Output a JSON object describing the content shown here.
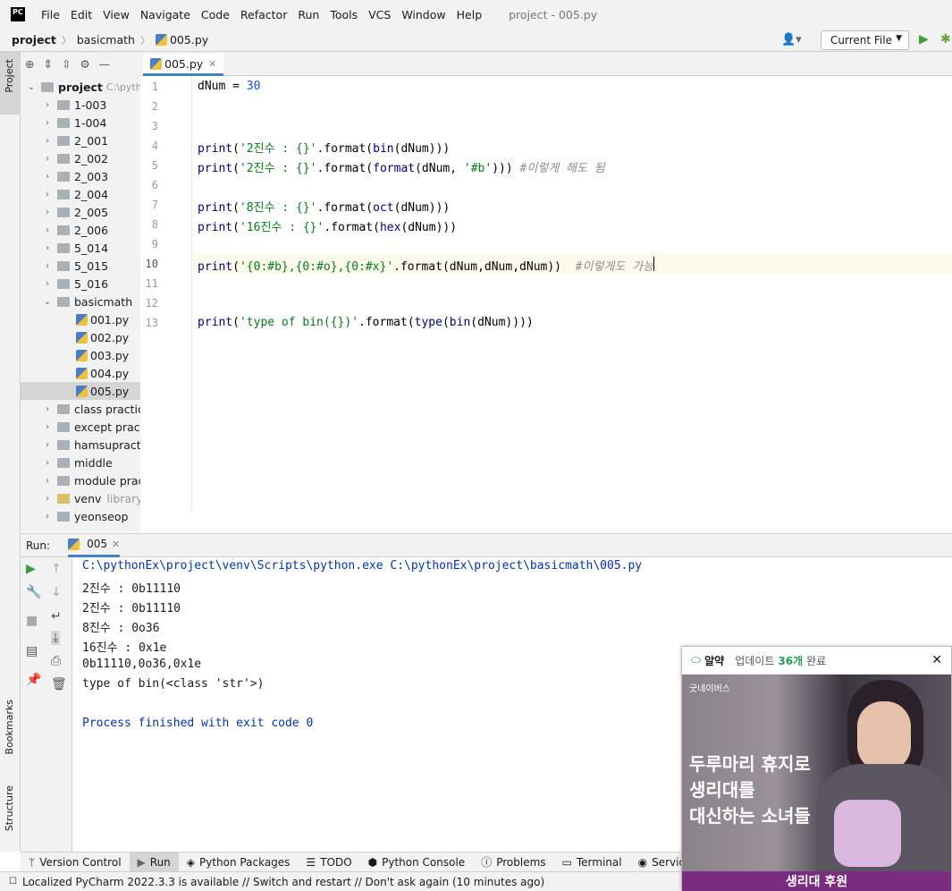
{
  "menubar": {
    "logo": "PC",
    "items": [
      "File",
      "Edit",
      "View",
      "Navigate",
      "Code",
      "Refactor",
      "Run",
      "Tools",
      "VCS",
      "Window",
      "Help"
    ],
    "window_title": "project - 005.py"
  },
  "navbar": {
    "crumbs": [
      "project",
      "basicmath",
      "005.py"
    ],
    "run_config": "Current File"
  },
  "side_tabs": {
    "project": "Project",
    "bookmarks": "Bookmarks",
    "structure": "Structure"
  },
  "project_tree": {
    "root": {
      "name": "project",
      "path": "C:\\pyth"
    },
    "folders_top": [
      "1-003",
      "1-004",
      "2_001",
      "2_002",
      "2_003",
      "2_004",
      "2_005",
      "2_006",
      "5_014",
      "5_015",
      "5_016"
    ],
    "open_folder": "basicmath",
    "files": [
      "001.py",
      "002.py",
      "003.py",
      "004.py",
      "005.py"
    ],
    "selected_file": "005.py",
    "folders_bottom": [
      "class practice",
      "except practic",
      "hamsupractic",
      "middle",
      "module pract"
    ],
    "venv": {
      "name": "venv",
      "hint": "library r"
    },
    "last_folder": "yeonseop"
  },
  "editor": {
    "tab": "005.py",
    "line_numbers": [
      "1",
      "2",
      "3",
      "4",
      "5",
      "6",
      "7",
      "8",
      "9",
      "10",
      "11",
      "12",
      "13"
    ],
    "current_line": 10
  },
  "run_panel": {
    "label": "Run:",
    "tab": "005.py",
    "tab_display": "005",
    "command": "C:\\pythonEx\\project\\venv\\Scripts\\python.exe C:\\pythonEx\\project\\basicmath\\005.py",
    "output": [
      "2진수 : 0b11110",
      "2진수 : 0b11110",
      "8진수 : 0o36",
      "16진수 : 0x1e",
      "0b11110,0o36,0x1e",
      "type of bin(<class 'str'>)"
    ],
    "exit": "Process finished with exit code 0"
  },
  "tool_windows": [
    "Version Control",
    "Run",
    "Python Packages",
    "TODO",
    "Python Console",
    "Problems",
    "Terminal",
    "Services"
  ],
  "status": "Localized PyCharm 2022.3.3 is available // Switch and restart // Don't ask again (10 minutes ago)",
  "ad": {
    "app": "알약",
    "update_pre": "업데이트",
    "update_count": "36개",
    "update_post": "완료",
    "brand": "굿네이버스",
    "headline": [
      "두루마리 휴지로",
      "생리대를",
      "대신하는 소녀들"
    ],
    "cta": "생리대 후원"
  }
}
